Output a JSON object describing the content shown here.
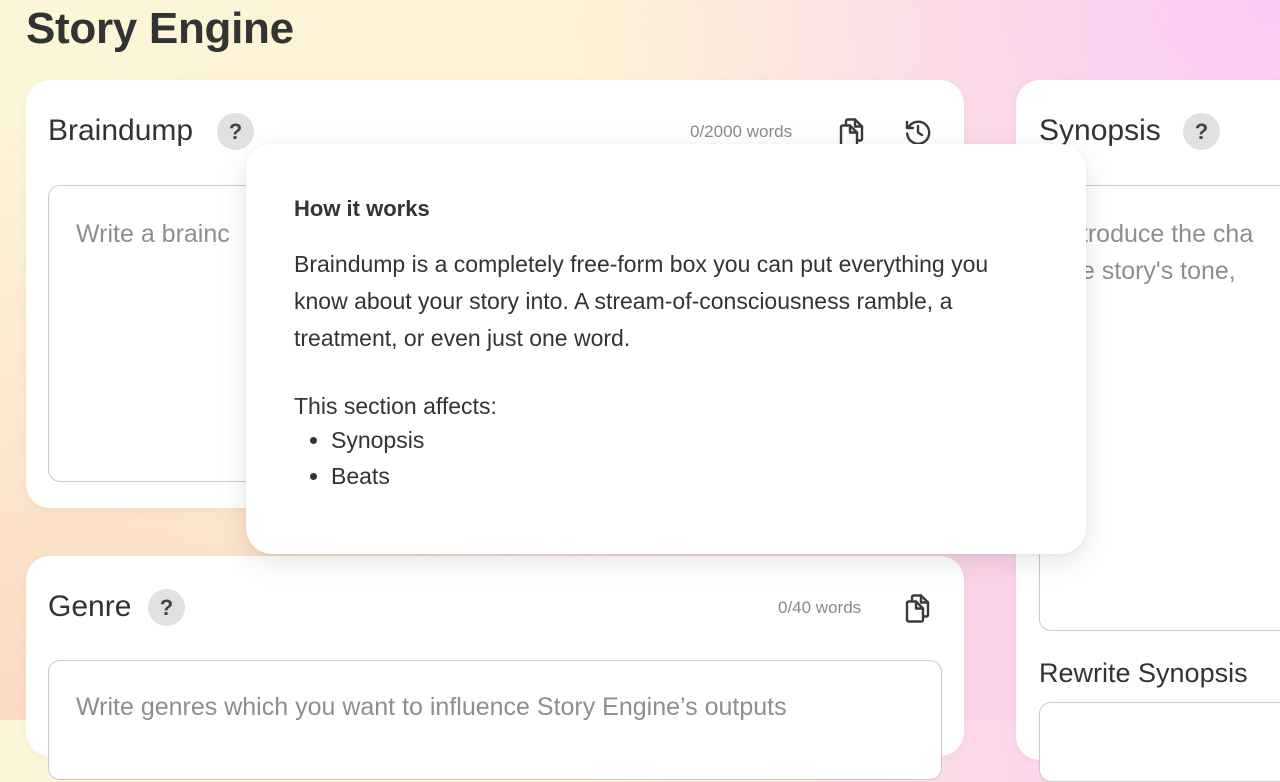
{
  "app": {
    "title": "Story Engine"
  },
  "braindump": {
    "title": "Braindump",
    "help_label": "?",
    "word_count": "0/2000 words",
    "placeholder_visible": "Write a brainc"
  },
  "synopsis": {
    "title": "Synopsis",
    "help_label": "?",
    "placeholder_line1": "ntroduce the cha",
    "placeholder_line2": "he story's tone,",
    "rewrite_label": "Rewrite Synopsis"
  },
  "genre": {
    "title": "Genre",
    "help_label": "?",
    "word_count": "0/40 words",
    "placeholder": "Write genres which you want to influence Story Engine’s outputs"
  },
  "tooltip": {
    "heading": "How it works",
    "body": "Braindump is a completely free-form box you can put everything you know about your story into. A stream-of-consciousness ramble, a treatment, or even just one word.",
    "affects_label": "This section affects:",
    "affects": [
      "Synopsis",
      "Beats"
    ]
  },
  "icons": {
    "copy": "copy-icon",
    "history": "history-icon"
  }
}
